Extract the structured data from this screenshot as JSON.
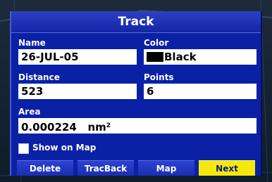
{
  "window": {
    "title": "Track"
  },
  "fields": {
    "name": {
      "label": "Name",
      "value": "26-JUL-05"
    },
    "color": {
      "label": "Color",
      "value": "Black",
      "swatch": "#000000"
    },
    "distance": {
      "label": "Distance",
      "value": "523"
    },
    "points": {
      "label": "Points",
      "value": "6"
    },
    "area": {
      "label": "Area",
      "value": "0.000224",
      "unit": "nm",
      "unit_exp": "2"
    }
  },
  "show_on_map": {
    "label": "Show on Map",
    "checked": false
  },
  "buttons": {
    "delete": "Delete",
    "tracback": "TracBack",
    "map": "Map",
    "next": "Next"
  },
  "colors": {
    "window_bg": "#0a21a6",
    "title_bar": "#1a2eb2",
    "selected_button": "#f5e80c"
  }
}
